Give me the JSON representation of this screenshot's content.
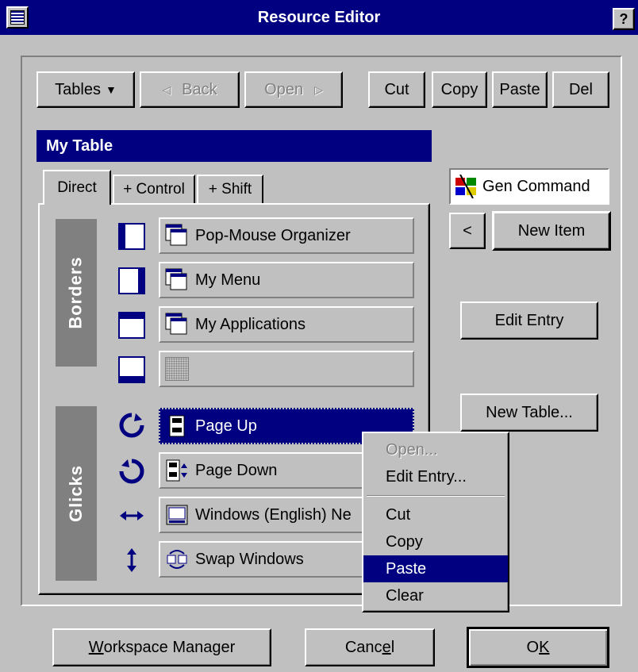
{
  "window": {
    "title": "Resource Editor",
    "help_label": "?"
  },
  "toolbar": {
    "tables_label": "Tables",
    "back_label": "Back",
    "open_label": "Open",
    "cut_label": "Cut",
    "copy_label": "Copy",
    "paste_label": "Paste",
    "del_label": "Del"
  },
  "table_title": "My Table",
  "tabs": [
    {
      "label": "Direct",
      "active": true
    },
    {
      "label": "+ Control",
      "active": false
    },
    {
      "label": "+ Shift",
      "active": false
    }
  ],
  "groups": {
    "borders_label": "Borders",
    "clicks_label": "Glicks"
  },
  "border_slots": [
    {
      "label": "Pop-Mouse Organizer",
      "icon": "window-icon"
    },
    {
      "label": "My Menu",
      "icon": "window-icon"
    },
    {
      "label": "My Applications",
      "icon": "window-icon"
    },
    {
      "label": "",
      "icon": "empty-slot-icon"
    }
  ],
  "click_slots": [
    {
      "label": "Page Up",
      "icon": "page-up-icon",
      "selected": true
    },
    {
      "label": "Page Down",
      "icon": "page-down-icon",
      "selected": false
    },
    {
      "label": "Windows (English) Ne",
      "icon": "keyboard-icon",
      "selected": false
    },
    {
      "label": "Swap Windows",
      "icon": "swap-windows-icon",
      "selected": false
    }
  ],
  "right_panel": {
    "gen_command_label": "Gen Command",
    "back_arrow_label": "<",
    "new_item_label": "New Item",
    "edit_entry_label": "Edit Entry",
    "new_table_label": "New Table..."
  },
  "context_menu": {
    "open_label": "Open...",
    "edit_entry_label": "Edit Entry...",
    "cut_label": "Cut",
    "copy_label": "Copy",
    "paste_label": "Paste",
    "clear_label": "Clear",
    "highlighted": "Paste"
  },
  "footer": {
    "workspace_label_pre": "",
    "workspace_label_key": "W",
    "workspace_label_post": "orkspace Manager",
    "cancel_label_pre": "Canc",
    "cancel_label_key": "e",
    "cancel_label_post": "l",
    "ok_label_pre": "O",
    "ok_label_key": "K",
    "ok_label_post": ""
  },
  "colors": {
    "navy": "#000080",
    "face": "#c0c0c0",
    "shadow": "#808080"
  }
}
